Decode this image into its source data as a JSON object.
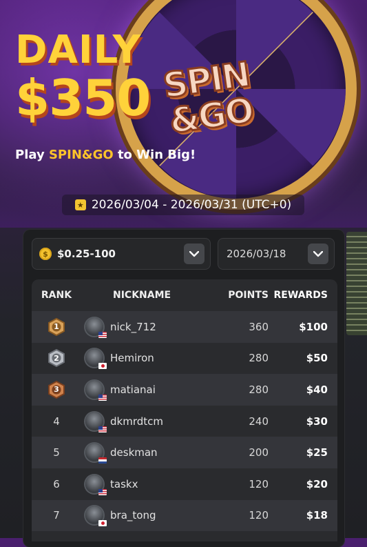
{
  "hero": {
    "title_line1": "DAILY",
    "title_line2": "$350",
    "logo_line1": "SPIN",
    "logo_line2": "&GO",
    "subtitle_prefix": "Play ",
    "subtitle_highlight": "SPIN&GO",
    "subtitle_suffix": " to Win Big!",
    "date_range": "2026/03/04 - 2026/03/31 (UTC+0)",
    "date_icon": "calendar-star-icon"
  },
  "filters": {
    "stake": {
      "value": "$0.25-100",
      "icon": "coin-icon",
      "coin_symbol": "$"
    },
    "date": {
      "value": "2026/03/18"
    }
  },
  "table": {
    "headers": {
      "rank": "RANK",
      "nickname": "NICKNAME",
      "points": "POINTS",
      "rewards": "REWARDS"
    },
    "rows": [
      {
        "rank": "1",
        "medal": "gold",
        "nickname": "nick_712",
        "flag": "us",
        "points": "360",
        "reward": "$100"
      },
      {
        "rank": "2",
        "medal": "silver",
        "nickname": "Hemiron",
        "flag": "jp",
        "points": "280",
        "reward": "$50"
      },
      {
        "rank": "3",
        "medal": "bronze",
        "nickname": "matianai",
        "flag": "us",
        "points": "280",
        "reward": "$40"
      },
      {
        "rank": "4",
        "medal": "",
        "nickname": "dkmrdtcm",
        "flag": "us",
        "points": "240",
        "reward": "$30"
      },
      {
        "rank": "5",
        "medal": "",
        "nickname": "deskman",
        "flag": "nl",
        "points": "200",
        "reward": "$25"
      },
      {
        "rank": "6",
        "medal": "",
        "nickname": "taskx",
        "flag": "us",
        "points": "120",
        "reward": "$20"
      },
      {
        "rank": "7",
        "medal": "",
        "nickname": "bra_tong",
        "flag": "jp",
        "points": "120",
        "reward": "$18"
      }
    ]
  },
  "colors": {
    "accent_yellow": "#ffd23a",
    "gold_medal": "#c98f45",
    "silver_medal": "#9a9ea6",
    "bronze_medal": "#b5683a"
  }
}
